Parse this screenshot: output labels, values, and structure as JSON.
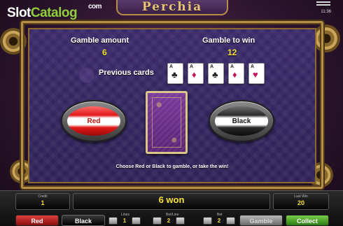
{
  "brand": {
    "logo_part1": "Slot",
    "logo_part2": "Catalog",
    "logo_suffix": "com"
  },
  "game": {
    "title": "Perchia",
    "clock": "11:36"
  },
  "gamble": {
    "amount_label": "Gamble amount",
    "amount_value": "6",
    "to_win_label": "Gamble to win",
    "to_win_value": "12",
    "previous_label": "Previous cards",
    "previous_cards": [
      {
        "rank": "A",
        "suit": "♣",
        "color": "black"
      },
      {
        "rank": "A",
        "suit": "♦",
        "color": "red"
      },
      {
        "rank": "A",
        "suit": "♣",
        "color": "black"
      },
      {
        "rank": "A",
        "suit": "♦",
        "color": "red"
      },
      {
        "rank": "A",
        "suit": "♥",
        "color": "red"
      }
    ],
    "red_label": "Red",
    "black_label": "Black",
    "instruction": "Choose Red or Black to gamble, or take the win!"
  },
  "panel": {
    "credit_label": "Credit",
    "credit_value": "1",
    "won_text": "6 won",
    "last_win_label": "Last Win",
    "last_win_value": "20",
    "lines_label": "Lines",
    "lines_value": "1",
    "betline_label": "Bet/Line",
    "betline_value": "2",
    "bet_label": "Bet",
    "bet_value": "2"
  },
  "buttons": {
    "red": "Red",
    "black": "Black",
    "gamble": "Gamble",
    "collect": "Collect"
  },
  "colors": {
    "accent_gold": "#b58f46",
    "value_yellow": "#f7e23a",
    "logo_green": "#8fcf3a"
  }
}
